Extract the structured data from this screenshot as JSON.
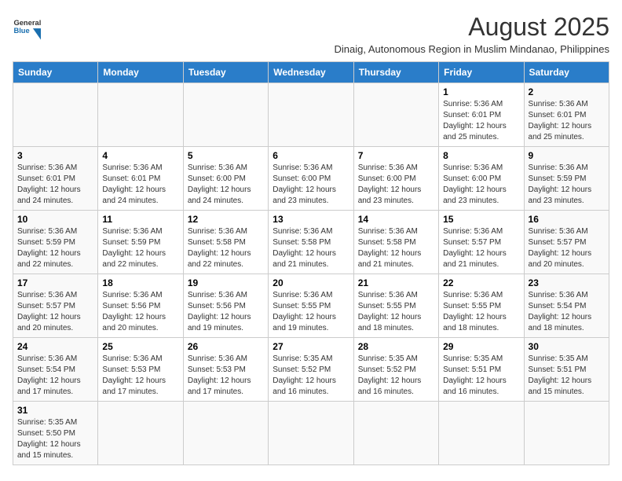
{
  "header": {
    "logo_text_general": "General",
    "logo_text_blue": "Blue",
    "month_year": "August 2025",
    "subtitle": "Dinaig, Autonomous Region in Muslim Mindanao, Philippines"
  },
  "calendar": {
    "days_of_week": [
      "Sunday",
      "Monday",
      "Tuesday",
      "Wednesday",
      "Thursday",
      "Friday",
      "Saturday"
    ],
    "weeks": [
      [
        {
          "day": "",
          "info": ""
        },
        {
          "day": "",
          "info": ""
        },
        {
          "day": "",
          "info": ""
        },
        {
          "day": "",
          "info": ""
        },
        {
          "day": "",
          "info": ""
        },
        {
          "day": "1",
          "info": "Sunrise: 5:36 AM\nSunset: 6:01 PM\nDaylight: 12 hours and 25 minutes."
        },
        {
          "day": "2",
          "info": "Sunrise: 5:36 AM\nSunset: 6:01 PM\nDaylight: 12 hours and 25 minutes."
        }
      ],
      [
        {
          "day": "3",
          "info": "Sunrise: 5:36 AM\nSunset: 6:01 PM\nDaylight: 12 hours and 24 minutes."
        },
        {
          "day": "4",
          "info": "Sunrise: 5:36 AM\nSunset: 6:01 PM\nDaylight: 12 hours and 24 minutes."
        },
        {
          "day": "5",
          "info": "Sunrise: 5:36 AM\nSunset: 6:00 PM\nDaylight: 12 hours and 24 minutes."
        },
        {
          "day": "6",
          "info": "Sunrise: 5:36 AM\nSunset: 6:00 PM\nDaylight: 12 hours and 23 minutes."
        },
        {
          "day": "7",
          "info": "Sunrise: 5:36 AM\nSunset: 6:00 PM\nDaylight: 12 hours and 23 minutes."
        },
        {
          "day": "8",
          "info": "Sunrise: 5:36 AM\nSunset: 6:00 PM\nDaylight: 12 hours and 23 minutes."
        },
        {
          "day": "9",
          "info": "Sunrise: 5:36 AM\nSunset: 5:59 PM\nDaylight: 12 hours and 23 minutes."
        }
      ],
      [
        {
          "day": "10",
          "info": "Sunrise: 5:36 AM\nSunset: 5:59 PM\nDaylight: 12 hours and 22 minutes."
        },
        {
          "day": "11",
          "info": "Sunrise: 5:36 AM\nSunset: 5:59 PM\nDaylight: 12 hours and 22 minutes."
        },
        {
          "day": "12",
          "info": "Sunrise: 5:36 AM\nSunset: 5:58 PM\nDaylight: 12 hours and 22 minutes."
        },
        {
          "day": "13",
          "info": "Sunrise: 5:36 AM\nSunset: 5:58 PM\nDaylight: 12 hours and 21 minutes."
        },
        {
          "day": "14",
          "info": "Sunrise: 5:36 AM\nSunset: 5:58 PM\nDaylight: 12 hours and 21 minutes."
        },
        {
          "day": "15",
          "info": "Sunrise: 5:36 AM\nSunset: 5:57 PM\nDaylight: 12 hours and 21 minutes."
        },
        {
          "day": "16",
          "info": "Sunrise: 5:36 AM\nSunset: 5:57 PM\nDaylight: 12 hours and 20 minutes."
        }
      ],
      [
        {
          "day": "17",
          "info": "Sunrise: 5:36 AM\nSunset: 5:57 PM\nDaylight: 12 hours and 20 minutes."
        },
        {
          "day": "18",
          "info": "Sunrise: 5:36 AM\nSunset: 5:56 PM\nDaylight: 12 hours and 20 minutes."
        },
        {
          "day": "19",
          "info": "Sunrise: 5:36 AM\nSunset: 5:56 PM\nDaylight: 12 hours and 19 minutes."
        },
        {
          "day": "20",
          "info": "Sunrise: 5:36 AM\nSunset: 5:55 PM\nDaylight: 12 hours and 19 minutes."
        },
        {
          "day": "21",
          "info": "Sunrise: 5:36 AM\nSunset: 5:55 PM\nDaylight: 12 hours and 18 minutes."
        },
        {
          "day": "22",
          "info": "Sunrise: 5:36 AM\nSunset: 5:55 PM\nDaylight: 12 hours and 18 minutes."
        },
        {
          "day": "23",
          "info": "Sunrise: 5:36 AM\nSunset: 5:54 PM\nDaylight: 12 hours and 18 minutes."
        }
      ],
      [
        {
          "day": "24",
          "info": "Sunrise: 5:36 AM\nSunset: 5:54 PM\nDaylight: 12 hours and 17 minutes."
        },
        {
          "day": "25",
          "info": "Sunrise: 5:36 AM\nSunset: 5:53 PM\nDaylight: 12 hours and 17 minutes."
        },
        {
          "day": "26",
          "info": "Sunrise: 5:36 AM\nSunset: 5:53 PM\nDaylight: 12 hours and 17 minutes."
        },
        {
          "day": "27",
          "info": "Sunrise: 5:35 AM\nSunset: 5:52 PM\nDaylight: 12 hours and 16 minutes."
        },
        {
          "day": "28",
          "info": "Sunrise: 5:35 AM\nSunset: 5:52 PM\nDaylight: 12 hours and 16 minutes."
        },
        {
          "day": "29",
          "info": "Sunrise: 5:35 AM\nSunset: 5:51 PM\nDaylight: 12 hours and 16 minutes."
        },
        {
          "day": "30",
          "info": "Sunrise: 5:35 AM\nSunset: 5:51 PM\nDaylight: 12 hours and 15 minutes."
        }
      ],
      [
        {
          "day": "31",
          "info": "Sunrise: 5:35 AM\nSunset: 5:50 PM\nDaylight: 12 hours and 15 minutes."
        },
        {
          "day": "",
          "info": ""
        },
        {
          "day": "",
          "info": ""
        },
        {
          "day": "",
          "info": ""
        },
        {
          "day": "",
          "info": ""
        },
        {
          "day": "",
          "info": ""
        },
        {
          "day": "",
          "info": ""
        }
      ]
    ]
  }
}
